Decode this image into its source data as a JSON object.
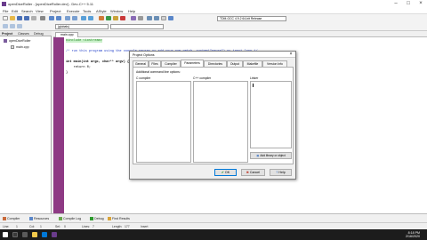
{
  "window": {
    "title": "openDiceRoller - [openDiceRoller.dev] - Dev-C++ 5.11"
  },
  "menu": [
    "File",
    "Edit",
    "Search",
    "View",
    "Project",
    "Execute",
    "Tools",
    "AStyle",
    "Window",
    "Help"
  ],
  "toolbar": {
    "compiler_combo": "TDM-GCC 4.9.2 64-bit Release",
    "scope_combo": "(globals)"
  },
  "project_panel": {
    "tabs": [
      "Project",
      "Classes",
      "Debug"
    ],
    "tree": [
      {
        "label": "openDiceRoller"
      },
      {
        "label": "main.cpp"
      }
    ]
  },
  "editor": {
    "tab": "main.cpp",
    "lines": [
      "#include <iostream>",
      "",
      "/* run this program using the console pauser or add your own getch, system(\"pause\") or input loop */",
      "",
      "int main(int argc, char** argv) {",
      "    return 0;",
      "}"
    ]
  },
  "dialog": {
    "title": "Project Options",
    "close_glyph": "×",
    "tabs": [
      "General",
      "Files",
      "Compiler",
      "Parameters",
      "Directories",
      "Output",
      "Makefile",
      "Version Info"
    ],
    "active_tab": "Parameters",
    "section_label": "Additional command line options:",
    "c_compiler_label": "C compiler",
    "cpp_compiler_label": "C++ compiler",
    "linker_label": "Linker",
    "add_library_button": "Add library or object",
    "ok_button": "OK",
    "cancel_button": "Cancel",
    "help_button": "Help"
  },
  "bottom_tabs": [
    "Compiler",
    "Resources",
    "Compile Log",
    "Debug",
    "Find Results"
  ],
  "status": {
    "line_label": "Line:",
    "line_value": "1",
    "col_label": "Col:",
    "col_value": "1",
    "sel_label": "Sel:",
    "sel_value": "0",
    "lines_label": "Lines:",
    "lines_value": "7",
    "length_label": "Length:",
    "length_value": "177",
    "mode": "Insert"
  },
  "taskbar": {
    "time": "8:18 PM",
    "date": "2/16/2020"
  },
  "colors": {
    "gutter": "#8e3a84",
    "include_line": "#2a8a2a",
    "comment": "#1e3cc8",
    "ok_check": "#2e9b2e",
    "cancel_x": "#c0392b"
  }
}
